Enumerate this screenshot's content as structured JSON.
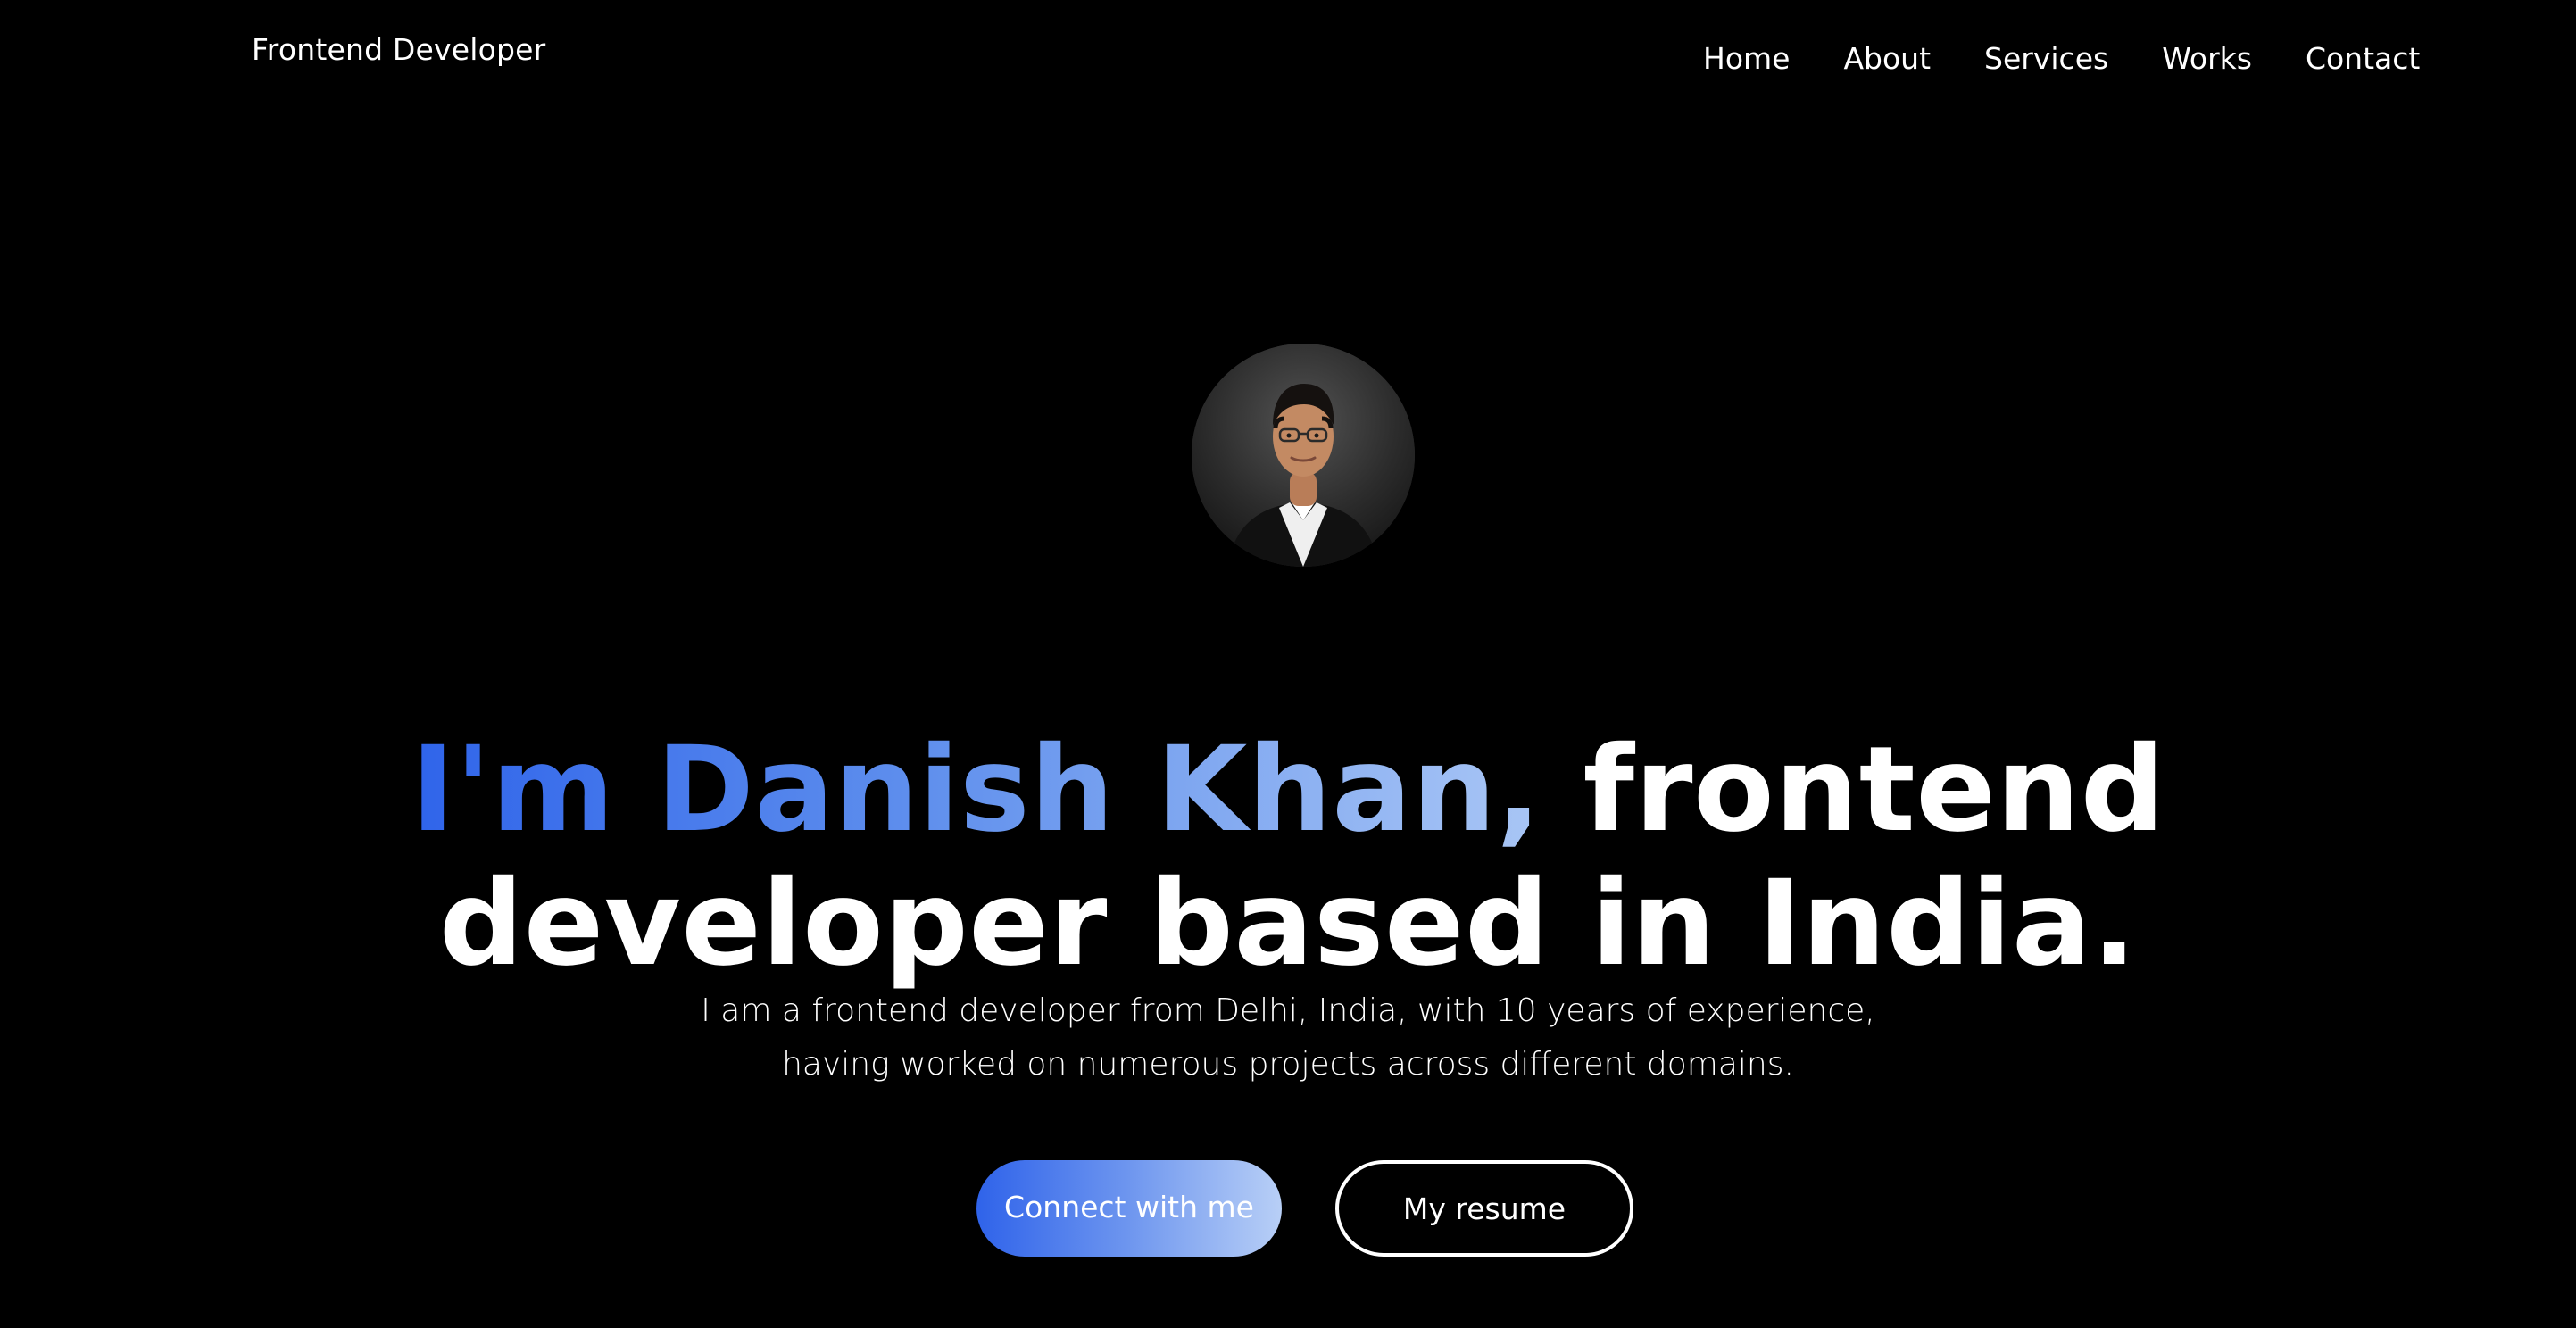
{
  "header": {
    "logo": "Frontend Developer",
    "nav": [
      "Home",
      "About",
      "Services",
      "Works",
      "Contact"
    ]
  },
  "hero": {
    "avatar_alt": "Danish Khan",
    "headline_highlight": "I'm Danish Khan,",
    "headline_rest_line1": "frontend",
    "headline_line2": "developer based in India.",
    "description_line1": "I am a frontend developer from Delhi, India, with 10 years of experience,",
    "description_line2": "having worked on numerous projects across different domains.",
    "primary_button": "Connect with me",
    "secondary_button": "My resume"
  },
  "colors": {
    "background": "#000000",
    "accent_start": "#2f63ea",
    "accent_end": "#b8cff6",
    "text": "#ffffff"
  }
}
